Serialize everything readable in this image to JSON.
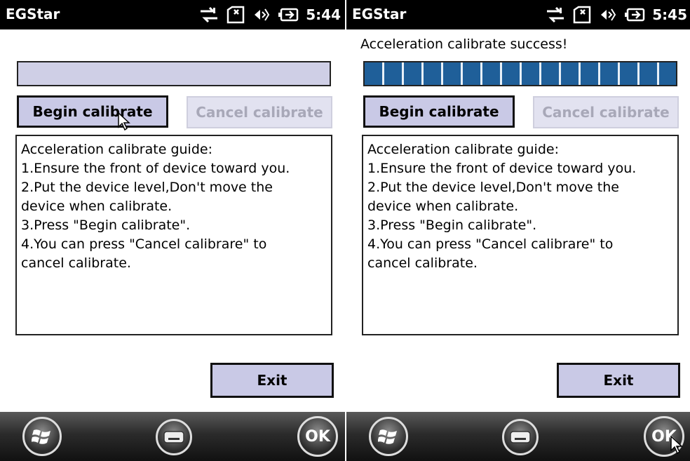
{
  "screens": [
    {
      "title": "EGStar",
      "clock": "5:44",
      "status_message": "",
      "progress_fraction": 0.0,
      "begin_label": "Begin calibrate",
      "cancel_label": "Cancel calibrate",
      "guide_lines": [
        "Acceleration calibrate guide:",
        "1.Ensure the front of device toward you.",
        "2.Put the device level,Don't move the",
        "device when calibrate.",
        "3.Press \"Begin calibrate\".",
        "4.You can press \"Cancel calibrare\" to",
        "cancel calibrate."
      ],
      "exit_label": "Exit",
      "ok_label": "OK"
    },
    {
      "title": "EGStar",
      "clock": "5:45",
      "status_message": "Acceleration calibrate success!",
      "progress_fraction": 1.0,
      "begin_label": "Begin calibrate",
      "cancel_label": "Cancel calibrate",
      "guide_lines": [
        "Acceleration calibrate guide:",
        "1.Ensure the front of device toward you.",
        "2.Put the device level,Don't move the",
        "device when calibrate.",
        "3.Press \"Begin calibrate\".",
        "4.You can press \"Cancel calibrare\" to",
        "cancel calibrate."
      ],
      "exit_label": "Exit",
      "ok_label": "OK"
    }
  ],
  "icons": {
    "connectivity": "connectivity-icon",
    "sim": "sim-icon",
    "volume": "volume-icon",
    "battery": "battery-icon",
    "start": "windows-start-icon",
    "keyboard": "keyboard-icon",
    "cursor": "mouse-pointer-icon"
  },
  "colors": {
    "titlebar": "#000000",
    "button_fill": "#c9c9e6",
    "progress_track": "#cfcfe6",
    "progress_block": "#1f5f99",
    "disabled_text": "#a8a8b8"
  }
}
